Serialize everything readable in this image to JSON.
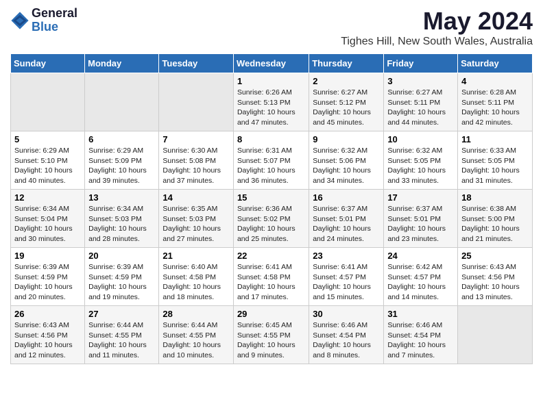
{
  "logo": {
    "general": "General",
    "blue": "Blue"
  },
  "title": "May 2024",
  "location": "Tighes Hill, New South Wales, Australia",
  "days_of_week": [
    "Sunday",
    "Monday",
    "Tuesday",
    "Wednesday",
    "Thursday",
    "Friday",
    "Saturday"
  ],
  "weeks": [
    [
      {
        "day": "",
        "empty": true
      },
      {
        "day": "",
        "empty": true
      },
      {
        "day": "",
        "empty": true
      },
      {
        "day": "1",
        "sunrise": "Sunrise: 6:26 AM",
        "sunset": "Sunset: 5:13 PM",
        "daylight": "Daylight: 10 hours and 47 minutes."
      },
      {
        "day": "2",
        "sunrise": "Sunrise: 6:27 AM",
        "sunset": "Sunset: 5:12 PM",
        "daylight": "Daylight: 10 hours and 45 minutes."
      },
      {
        "day": "3",
        "sunrise": "Sunrise: 6:27 AM",
        "sunset": "Sunset: 5:11 PM",
        "daylight": "Daylight: 10 hours and 44 minutes."
      },
      {
        "day": "4",
        "sunrise": "Sunrise: 6:28 AM",
        "sunset": "Sunset: 5:11 PM",
        "daylight": "Daylight: 10 hours and 42 minutes."
      }
    ],
    [
      {
        "day": "5",
        "sunrise": "Sunrise: 6:29 AM",
        "sunset": "Sunset: 5:10 PM",
        "daylight": "Daylight: 10 hours and 40 minutes."
      },
      {
        "day": "6",
        "sunrise": "Sunrise: 6:29 AM",
        "sunset": "Sunset: 5:09 PM",
        "daylight": "Daylight: 10 hours and 39 minutes."
      },
      {
        "day": "7",
        "sunrise": "Sunrise: 6:30 AM",
        "sunset": "Sunset: 5:08 PM",
        "daylight": "Daylight: 10 hours and 37 minutes."
      },
      {
        "day": "8",
        "sunrise": "Sunrise: 6:31 AM",
        "sunset": "Sunset: 5:07 PM",
        "daylight": "Daylight: 10 hours and 36 minutes."
      },
      {
        "day": "9",
        "sunrise": "Sunrise: 6:32 AM",
        "sunset": "Sunset: 5:06 PM",
        "daylight": "Daylight: 10 hours and 34 minutes."
      },
      {
        "day": "10",
        "sunrise": "Sunrise: 6:32 AM",
        "sunset": "Sunset: 5:05 PM",
        "daylight": "Daylight: 10 hours and 33 minutes."
      },
      {
        "day": "11",
        "sunrise": "Sunrise: 6:33 AM",
        "sunset": "Sunset: 5:05 PM",
        "daylight": "Daylight: 10 hours and 31 minutes."
      }
    ],
    [
      {
        "day": "12",
        "sunrise": "Sunrise: 6:34 AM",
        "sunset": "Sunset: 5:04 PM",
        "daylight": "Daylight: 10 hours and 30 minutes."
      },
      {
        "day": "13",
        "sunrise": "Sunrise: 6:34 AM",
        "sunset": "Sunset: 5:03 PM",
        "daylight": "Daylight: 10 hours and 28 minutes."
      },
      {
        "day": "14",
        "sunrise": "Sunrise: 6:35 AM",
        "sunset": "Sunset: 5:03 PM",
        "daylight": "Daylight: 10 hours and 27 minutes."
      },
      {
        "day": "15",
        "sunrise": "Sunrise: 6:36 AM",
        "sunset": "Sunset: 5:02 PM",
        "daylight": "Daylight: 10 hours and 25 minutes."
      },
      {
        "day": "16",
        "sunrise": "Sunrise: 6:37 AM",
        "sunset": "Sunset: 5:01 PM",
        "daylight": "Daylight: 10 hours and 24 minutes."
      },
      {
        "day": "17",
        "sunrise": "Sunrise: 6:37 AM",
        "sunset": "Sunset: 5:01 PM",
        "daylight": "Daylight: 10 hours and 23 minutes."
      },
      {
        "day": "18",
        "sunrise": "Sunrise: 6:38 AM",
        "sunset": "Sunset: 5:00 PM",
        "daylight": "Daylight: 10 hours and 21 minutes."
      }
    ],
    [
      {
        "day": "19",
        "sunrise": "Sunrise: 6:39 AM",
        "sunset": "Sunset: 4:59 PM",
        "daylight": "Daylight: 10 hours and 20 minutes."
      },
      {
        "day": "20",
        "sunrise": "Sunrise: 6:39 AM",
        "sunset": "Sunset: 4:59 PM",
        "daylight": "Daylight: 10 hours and 19 minutes."
      },
      {
        "day": "21",
        "sunrise": "Sunrise: 6:40 AM",
        "sunset": "Sunset: 4:58 PM",
        "daylight": "Daylight: 10 hours and 18 minutes."
      },
      {
        "day": "22",
        "sunrise": "Sunrise: 6:41 AM",
        "sunset": "Sunset: 4:58 PM",
        "daylight": "Daylight: 10 hours and 17 minutes."
      },
      {
        "day": "23",
        "sunrise": "Sunrise: 6:41 AM",
        "sunset": "Sunset: 4:57 PM",
        "daylight": "Daylight: 10 hours and 15 minutes."
      },
      {
        "day": "24",
        "sunrise": "Sunrise: 6:42 AM",
        "sunset": "Sunset: 4:57 PM",
        "daylight": "Daylight: 10 hours and 14 minutes."
      },
      {
        "day": "25",
        "sunrise": "Sunrise: 6:43 AM",
        "sunset": "Sunset: 4:56 PM",
        "daylight": "Daylight: 10 hours and 13 minutes."
      }
    ],
    [
      {
        "day": "26",
        "sunrise": "Sunrise: 6:43 AM",
        "sunset": "Sunset: 4:56 PM",
        "daylight": "Daylight: 10 hours and 12 minutes."
      },
      {
        "day": "27",
        "sunrise": "Sunrise: 6:44 AM",
        "sunset": "Sunset: 4:55 PM",
        "daylight": "Daylight: 10 hours and 11 minutes."
      },
      {
        "day": "28",
        "sunrise": "Sunrise: 6:44 AM",
        "sunset": "Sunset: 4:55 PM",
        "daylight": "Daylight: 10 hours and 10 minutes."
      },
      {
        "day": "29",
        "sunrise": "Sunrise: 6:45 AM",
        "sunset": "Sunset: 4:55 PM",
        "daylight": "Daylight: 10 hours and 9 minutes."
      },
      {
        "day": "30",
        "sunrise": "Sunrise: 6:46 AM",
        "sunset": "Sunset: 4:54 PM",
        "daylight": "Daylight: 10 hours and 8 minutes."
      },
      {
        "day": "31",
        "sunrise": "Sunrise: 6:46 AM",
        "sunset": "Sunset: 4:54 PM",
        "daylight": "Daylight: 10 hours and 7 minutes."
      },
      {
        "day": "",
        "empty": true
      }
    ]
  ]
}
